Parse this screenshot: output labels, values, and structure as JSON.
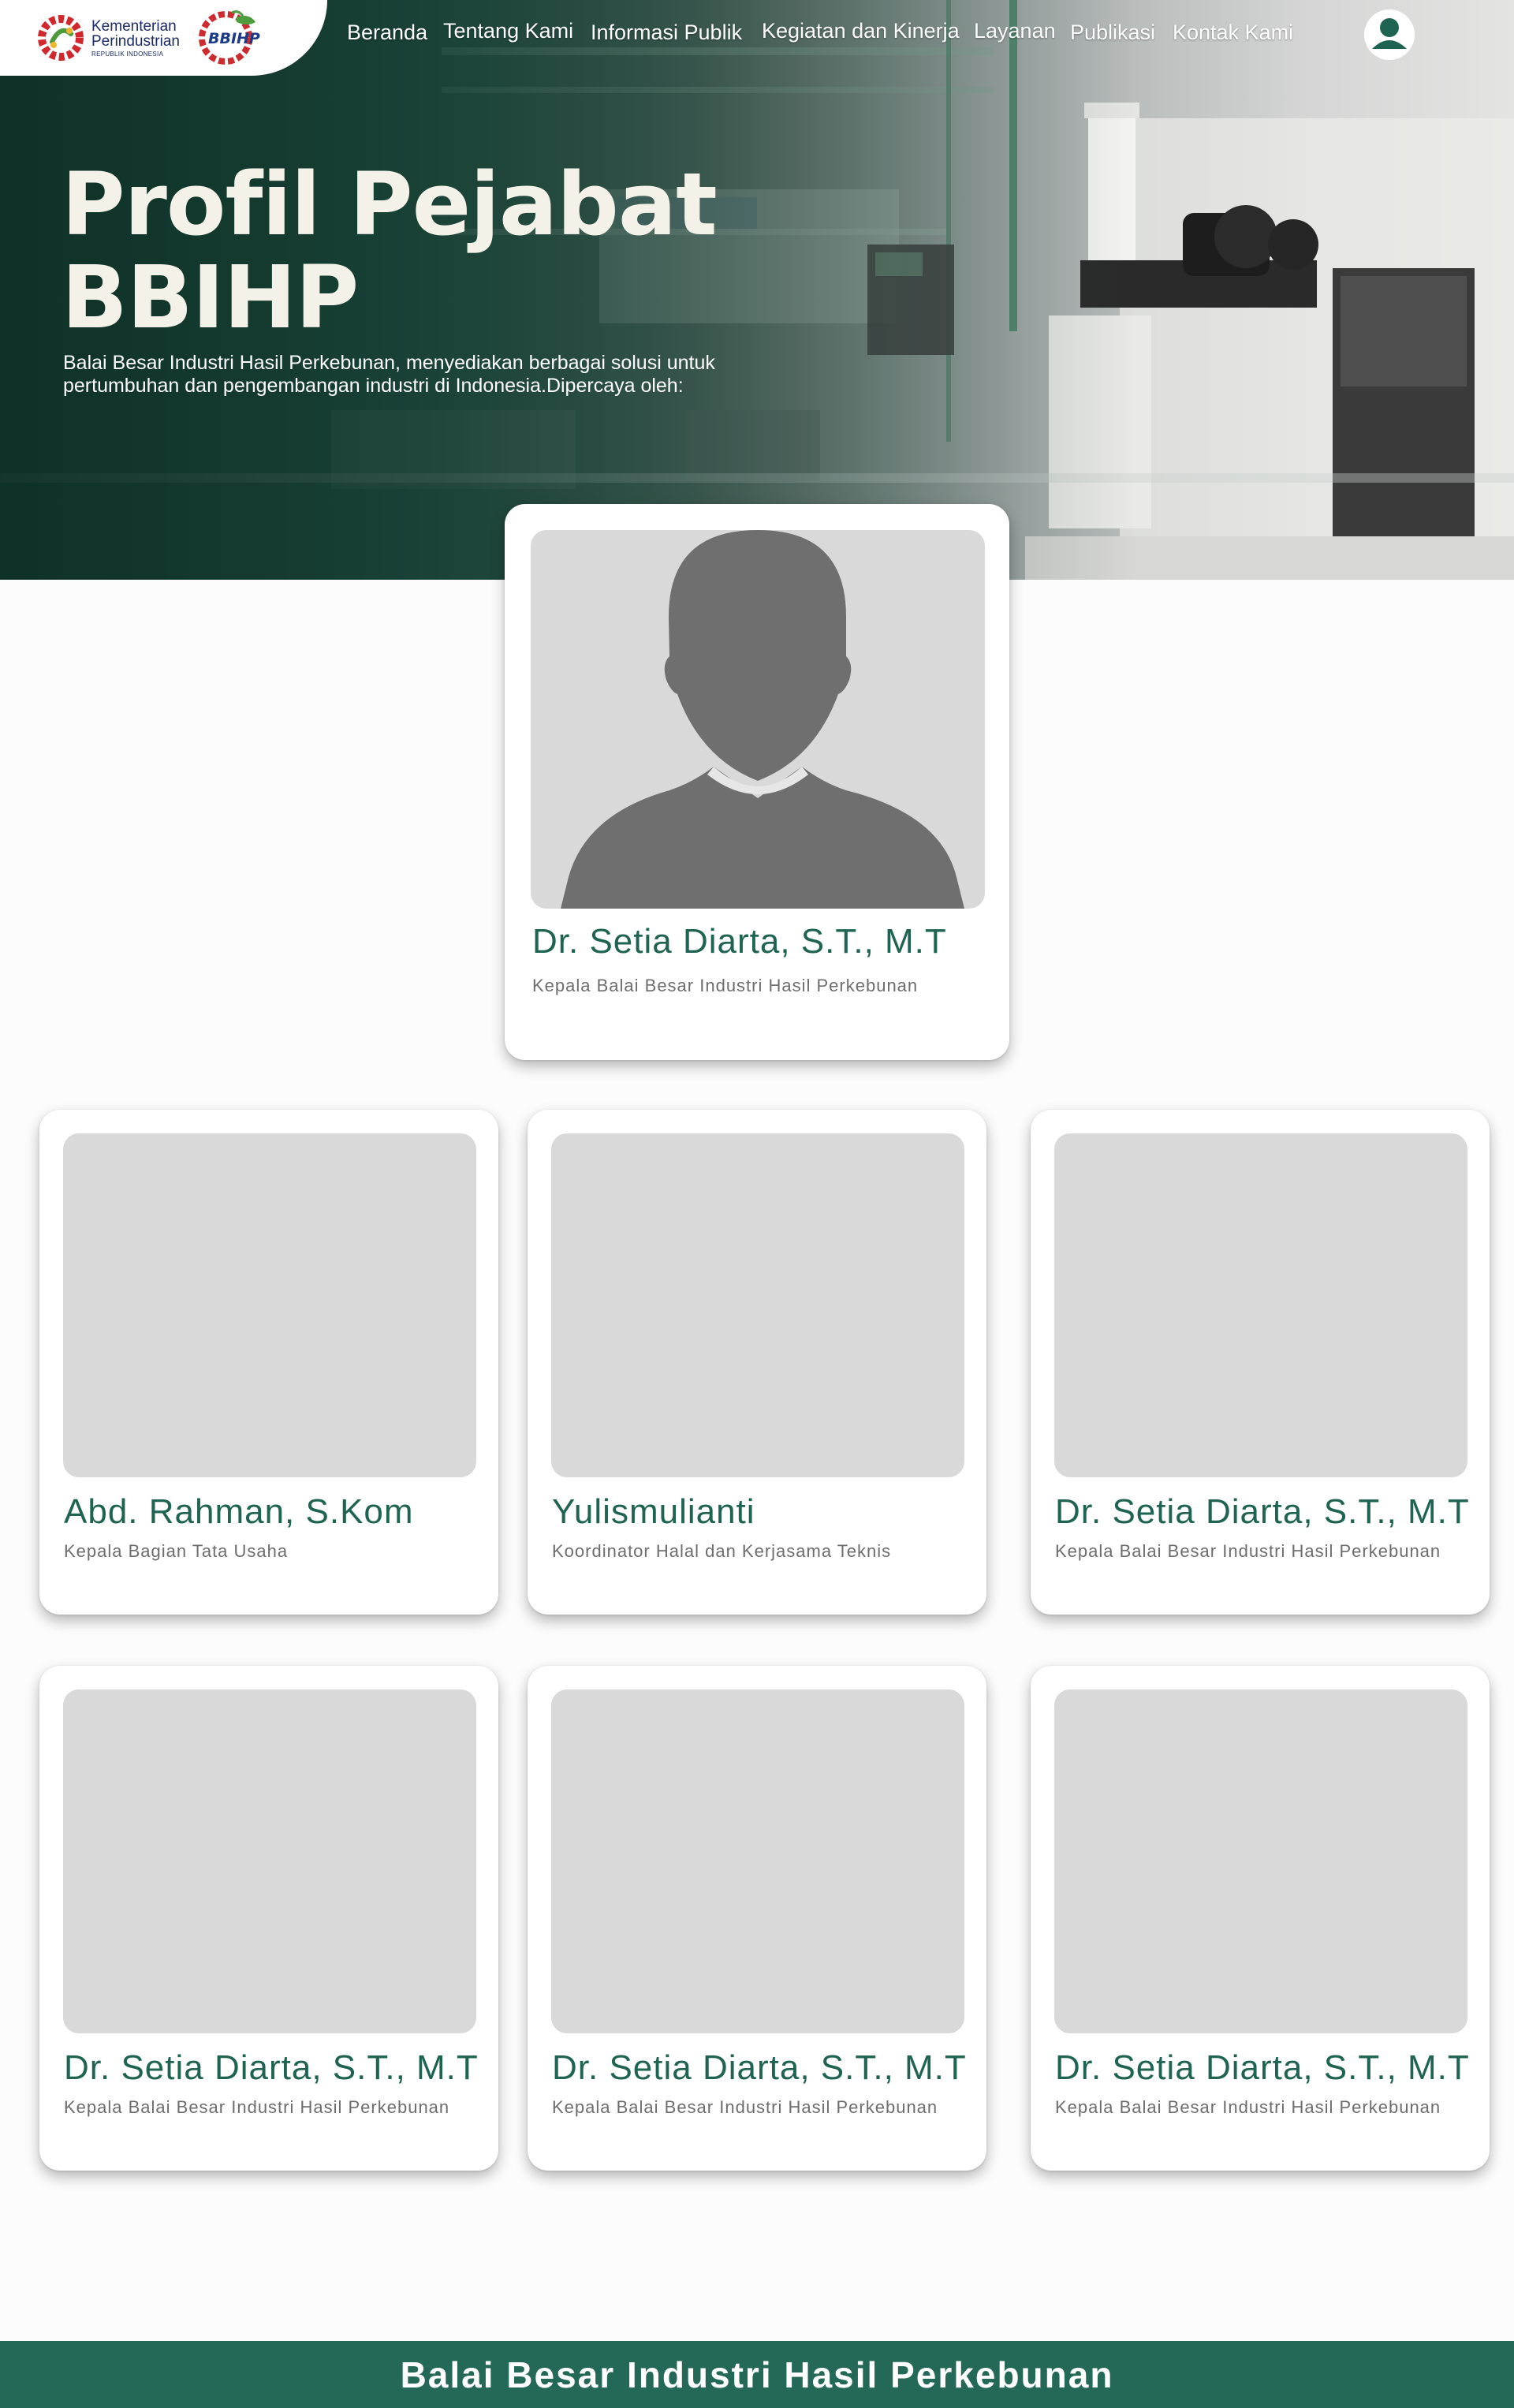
{
  "header": {
    "logo_kemenperin": {
      "line1": "Kementerian",
      "line2": "Perindustrian",
      "line3": "REPUBLIK INDONESIA"
    },
    "logo_bbihp": "BBIHP",
    "nav": [
      {
        "label": "Beranda"
      },
      {
        "label": "Tentang Kami"
      },
      {
        "label": "Informasi Publik"
      },
      {
        "label": "Kegiatan dan Kinerja"
      },
      {
        "label": "Layanan"
      },
      {
        "label": "Publikasi"
      },
      {
        "label": "Kontak Kami"
      }
    ],
    "user_icon": "user-icon"
  },
  "hero": {
    "title_line1": "Profil Pejabat",
    "title_line2": "BBIHP",
    "subtitle_line1": "Balai Besar Industri Hasil Perkebunan, menyediakan berbagai solusi untuk",
    "subtitle_line2": "pertumbuhan dan pengembangan industri di Indonesia.Dipercaya oleh:"
  },
  "featured": {
    "name": "Dr. Setia Diarta, S.T., M.T",
    "role": "Kepala Balai Besar Industri Hasil Perkebunan"
  },
  "officials": [
    {
      "name": "Abd. Rahman, S.Kom",
      "role": "Kepala Bagian Tata Usaha"
    },
    {
      "name": "Yulismulianti",
      "role": "Koordinator Halal dan Kerjasama Teknis"
    },
    {
      "name": "Dr. Setia Diarta, S.T., M.T",
      "role": "Kepala Balai Besar Industri Hasil Perkebunan"
    },
    {
      "name": "Dr. Setia Diarta, S.T., M.T",
      "role": "Kepala Balai Besar Industri Hasil Perkebunan"
    },
    {
      "name": "Dr. Setia Diarta, S.T., M.T",
      "role": "Kepala Balai Besar Industri Hasil Perkebunan"
    },
    {
      "name": "Dr. Setia Diarta, S.T., M.T",
      "role": "Kepala Balai Besar Industri Hasil Perkebunan"
    }
  ],
  "footer": {
    "text": "Balai Besar Industri Hasil Perkebunan"
  },
  "colors": {
    "brand_green": "#246958",
    "name_green": "#1f6452",
    "placeholder_gray": "#d9d9d9"
  }
}
